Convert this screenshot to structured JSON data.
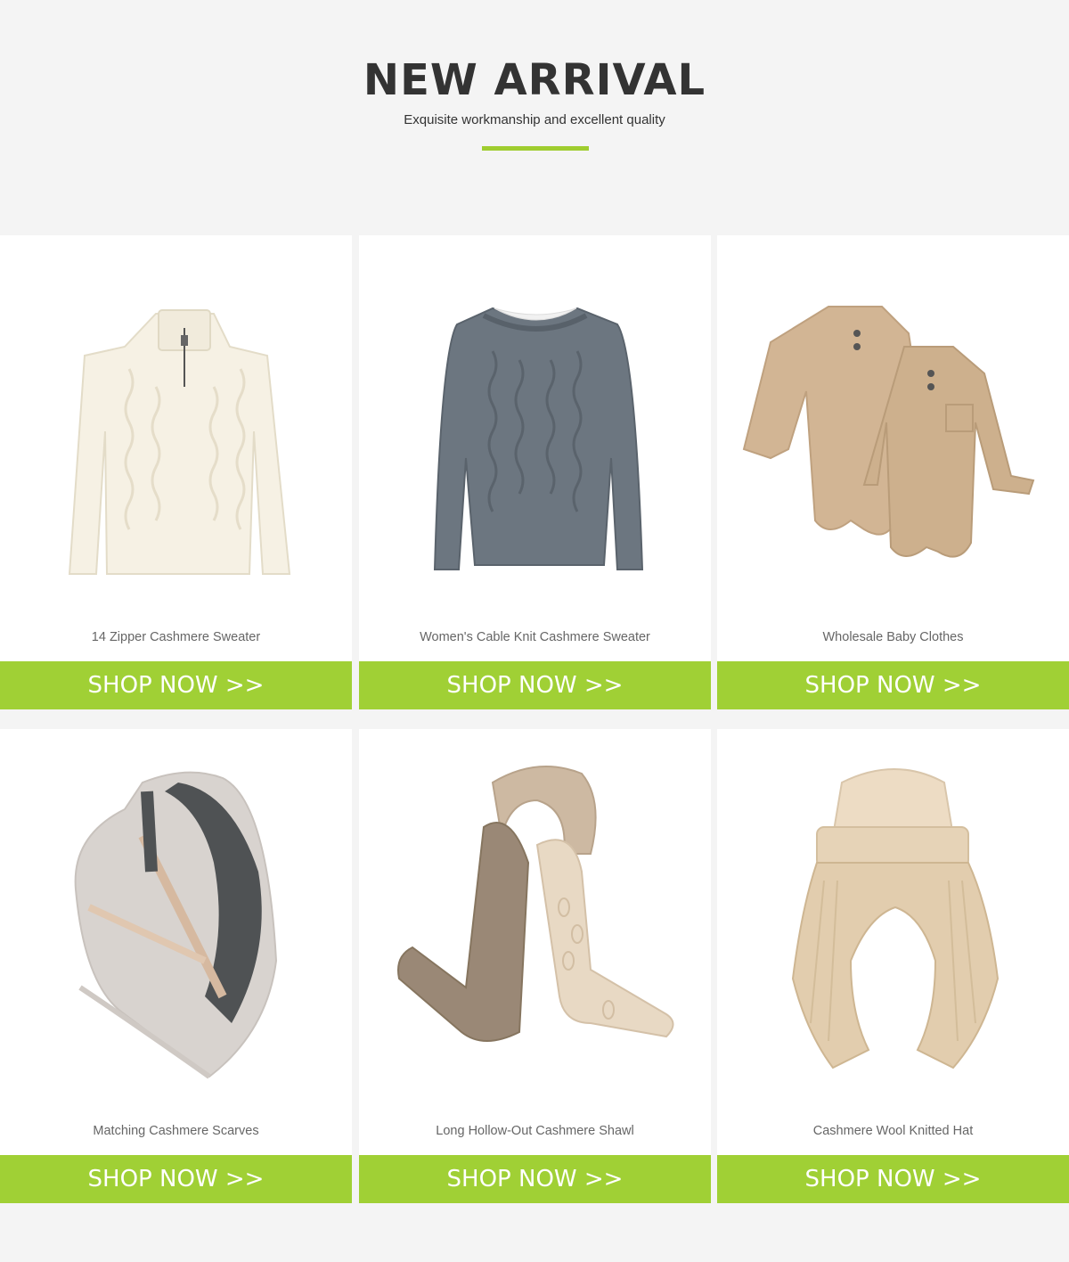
{
  "header": {
    "title": "NEW ARRIVAL",
    "subtitle": "Exquisite workmanship and excellent quality",
    "accent_color": "#9fcd2f"
  },
  "products": [
    {
      "name": "14 Zipper Cashmere Sweater",
      "button": "SHOP NOW >>",
      "image": "cream-half-zip-cable-knit-sweater"
    },
    {
      "name": "Women's Cable Knit Cashmere Sweater",
      "button": "SHOP NOW >>",
      "image": "grey-cable-knit-crewneck-sweater"
    },
    {
      "name": "Wholesale Baby Clothes",
      "button": "SHOP NOW >>",
      "image": "two-camel-knit-baby-rompers"
    },
    {
      "name": "Matching Cashmere Scarves",
      "button": "SHOP NOW >>",
      "image": "grey-beige-striped-scarf"
    },
    {
      "name": "Long Hollow-Out Cashmere Shawl",
      "button": "SHOP NOW >>",
      "image": "brown-cream-openwork-shawl"
    },
    {
      "name": "Cashmere Wool Knitted Hat",
      "button": "SHOP NOW >>",
      "image": "beige-knitted-hood-scarf-hat"
    }
  ],
  "colors": {
    "button_bg": "#a0d035",
    "button_text": "#ffffff",
    "page_bg": "#f4f4f4",
    "card_bg": "#ffffff"
  }
}
